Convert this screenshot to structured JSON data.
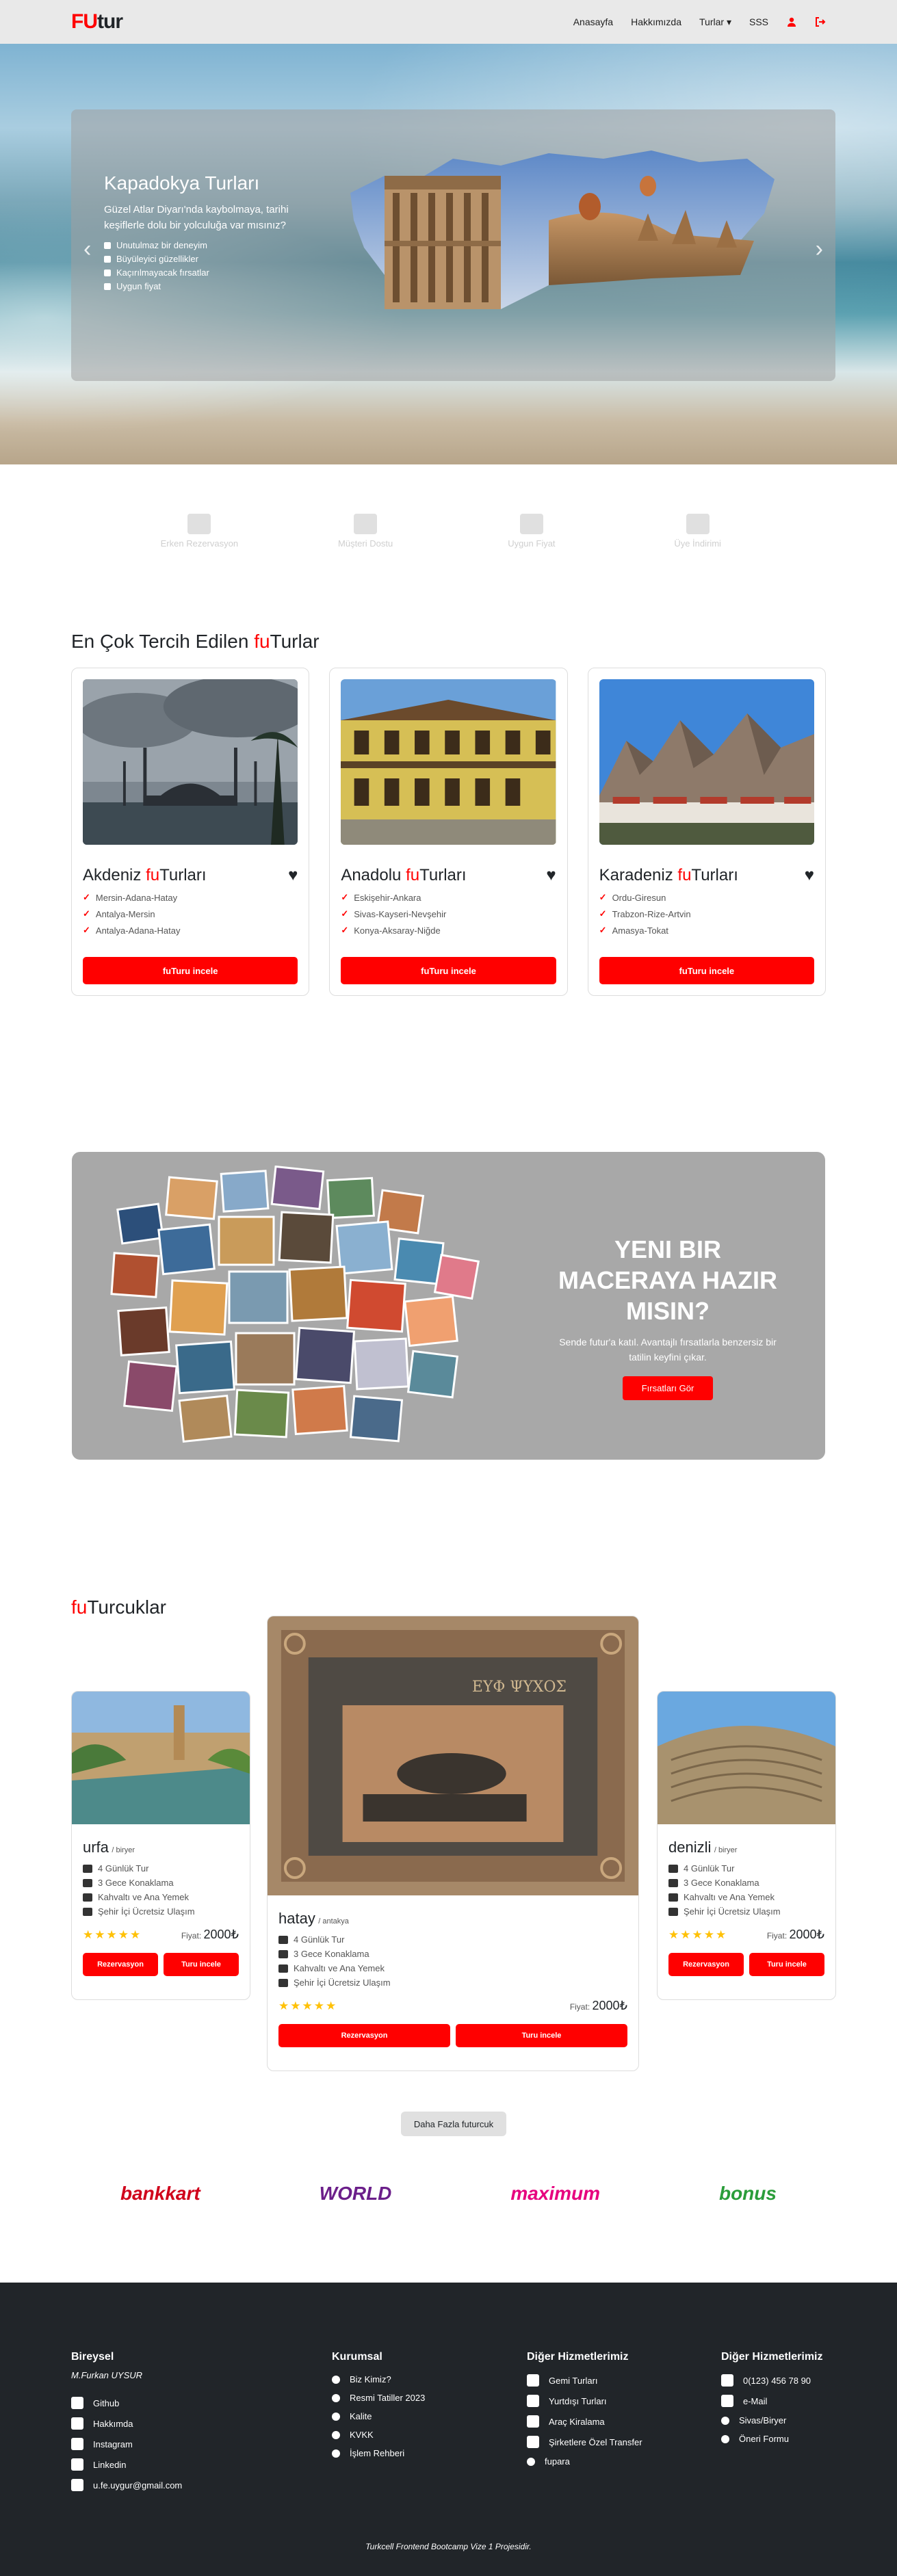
{
  "navbar": {
    "brand_fu": "FU",
    "brand_tur": "tur",
    "links": [
      "Anasayfa",
      "Hakkımızda",
      "Turlar",
      "SSS"
    ]
  },
  "hero": {
    "title": "Kapadokya Turları",
    "description": "Güzel Atlar Diyarı'nda kaybolmaya, tarihi keşiflerle dolu bir yolculuğa var mısınız?",
    "bullets": [
      "Unutulmaz bir deneyim",
      "Büyüleyici güzellikler",
      "Kaçırılmayacak fırsatlar",
      "Uygun fiyat"
    ]
  },
  "features": [
    {
      "label": "Erken Rezervasyon"
    },
    {
      "label": "Müşteri Dostu"
    },
    {
      "label": "Uygun Fiyat"
    },
    {
      "label": "Üye İndirimi"
    }
  ],
  "popular": {
    "title_prefix": "En Çok Tercih Edilen ",
    "title_fu": "fu",
    "title_suffix": "Turlar",
    "cards": [
      {
        "name_prefix": "Akdeniz ",
        "name_fu": "fu",
        "name_suffix": "Turları",
        "items": [
          "Mersin-Adana-Hatay",
          "Antalya-Mersin",
          "Antalya-Adana-Hatay"
        ],
        "button": "fuTuru incele"
      },
      {
        "name_prefix": "Anadolu ",
        "name_fu": "fu",
        "name_suffix": "Turları",
        "items": [
          "Eskişehir-Ankara",
          "Sivas-Kayseri-Nevşehir",
          "Konya-Aksaray-Niğde"
        ],
        "button": "fuTuru incele"
      },
      {
        "name_prefix": "Karadeniz ",
        "name_fu": "fu",
        "name_suffix": "Turları",
        "items": [
          "Ordu-Giresun",
          "Trabzon-Rize-Artvin",
          "Amasya-Tokat"
        ],
        "button": "fuTuru incele"
      }
    ]
  },
  "promo": {
    "title": "YENI BIR MACERAYA HAZIR MISIN?",
    "text": "Sende futur'a katıl. Avantajlı fırsatlarla benzersiz bir tatilin keyfini çıkar.",
    "button": "Fırsatları Gör"
  },
  "guides": {
    "title_fu": "fu",
    "title_suffix": "Turcuklar",
    "cards": [
      {
        "city": "urfa",
        "region": "/ biryer",
        "items": [
          "4 Günlük Tur",
          "3 Gece Konaklama",
          "Kahvaltı ve Ana Yemek",
          "Şehir İçi Ücretsiz Ulaşım"
        ],
        "stars": "★★★★★",
        "price_label": "Fiyat:",
        "price": "2000₺",
        "btn_reserve": "Rezervasyon",
        "btn_view": "Turu incele"
      },
      {
        "city": "hatay",
        "region": "/ antakya",
        "items": [
          "4 Günlük Tur",
          "3 Gece Konaklama",
          "Kahvaltı ve Ana Yemek",
          "Şehir İçi Ücretsiz Ulaşım"
        ],
        "stars": "★★★★★",
        "price_label": "Fiyat:",
        "price": "2000₺",
        "btn_reserve": "Rezervasyon",
        "btn_view": "Turu incele"
      },
      {
        "city": "denizli",
        "region": "/ biryer",
        "items": [
          "4 Günlük Tur",
          "3 Gece Konaklama",
          "Kahvaltı ve Ana Yemek",
          "Şehir İçi Ücretsiz Ulaşım"
        ],
        "stars": "★★★★★",
        "price_label": "Fiyat:",
        "price": "2000₺",
        "btn_reserve": "Rezervasyon",
        "btn_view": "Turu incele"
      }
    ],
    "more_button": "Daha Fazla futurcuk"
  },
  "logos": [
    "bankkart",
    "WORLD",
    "maximum",
    "bonus"
  ],
  "footer": {
    "col1": {
      "title": "Bireysel",
      "subtitle": "M.Furkan UYSUR",
      "items": [
        "Github",
        "Hakkımda",
        "Instagram",
        "Linkedin",
        "u.fe.uygur@gmail.com"
      ]
    },
    "col2": {
      "title": "Kurumsal",
      "items": [
        "Biz Kimiz?",
        "Resmi Tatiller 2023",
        "Kalite",
        "KVKK",
        "İşlem Rehberi"
      ]
    },
    "col3": {
      "title": "Diğer Hizmetlerimiz",
      "items": [
        "Gemi Turları",
        "Yurtdışı Turları",
        "Araç Kiralama",
        "Şirketlere Özel Transfer",
        "fupara"
      ]
    },
    "col4": {
      "title": "Diğer Hizmetlerimiz",
      "items": [
        "0(123) 456 78 90",
        "e-Mail",
        "Sivas/Biryer",
        "Öneri Formu"
      ]
    },
    "credit": "Turkcell Frontend Bootcamp Vize 1 Projesidir."
  }
}
